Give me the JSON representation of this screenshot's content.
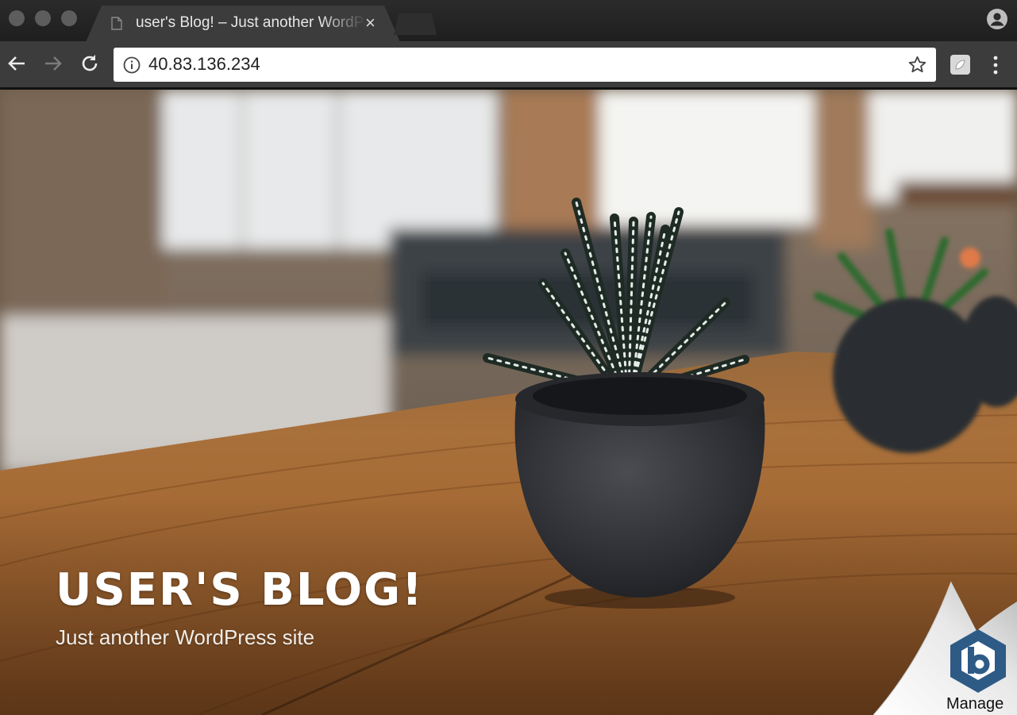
{
  "browser": {
    "tab_title": "user's Blog! – Just another WordPress site",
    "tab_close": "×",
    "url": "40.83.136.234"
  },
  "site": {
    "title": "USER'S BLOG!",
    "tagline": "Just another WordPress site"
  },
  "manage_badge": {
    "logo_letter": "b",
    "label": "Manage"
  },
  "icons": {
    "window_controls": [
      "close-dot-icon",
      "minimize-dot-icon",
      "zoom-dot-icon"
    ],
    "tab_favicon": "document-icon",
    "profile": "account-circle-icon",
    "back": "arrow-left-icon",
    "forward": "arrow-right-icon",
    "reload": "reload-icon",
    "site_info": "info-circle-icon",
    "bookmark": "star-outline-icon",
    "extension": "extension-icon",
    "menu": "vertical-dots-icon"
  },
  "colors": {
    "chrome_dark": "#1e1e1e",
    "toolbar": "#3c3c3c",
    "table_wood": "#b06a2c",
    "pot": "#2f3136",
    "bitnami_blue": "#2e5b86"
  }
}
